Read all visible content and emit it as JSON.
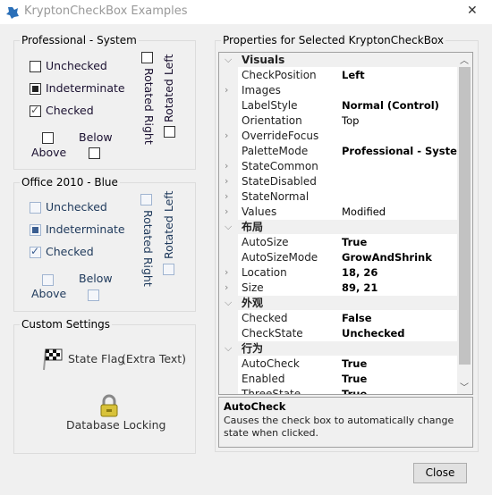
{
  "window": {
    "title": "KryptonCheckBox Examples"
  },
  "groups": {
    "professional": {
      "title": "Professional - System",
      "unchecked": "Unchecked",
      "indeterminate": "Indeterminate",
      "checked": "Checked",
      "above": "Above",
      "below": "Below",
      "rotated_right": "Rotated Right",
      "rotated_left": "Rotated Left"
    },
    "office": {
      "title": "Office 2010 - Blue",
      "unchecked": "Unchecked",
      "indeterminate": "Indeterminate",
      "checked": "Checked",
      "above": "Above",
      "below": "Below",
      "rotated_right": "Rotated Right",
      "rotated_left": "Rotated Left"
    },
    "custom": {
      "title": "Custom Settings",
      "state_flag": "State Flag",
      "extra_text": "(Extra Text)",
      "database_locking": "Database Locking"
    }
  },
  "properties": {
    "title": "Properties for Selected KryptonCheckBox",
    "rows": [
      {
        "label": "Visuals",
        "type": "category"
      },
      {
        "label": "CheckPosition",
        "value": "Left",
        "bold": true
      },
      {
        "label": "Images",
        "value": "",
        "expand": true
      },
      {
        "label": "LabelStyle",
        "value": "Normal (Control)",
        "bold": true
      },
      {
        "label": "Orientation",
        "value": "Top"
      },
      {
        "label": "OverrideFocus",
        "value": "",
        "expand": true
      },
      {
        "label": "PaletteMode",
        "value": "Professional - System",
        "bold": true
      },
      {
        "label": "StateCommon",
        "value": "",
        "expand": true
      },
      {
        "label": "StateDisabled",
        "value": "",
        "expand": true
      },
      {
        "label": "StateNormal",
        "value": "",
        "expand": true
      },
      {
        "label": "Values",
        "value": "Modified",
        "expand": true
      },
      {
        "label": "布局",
        "type": "category"
      },
      {
        "label": "AutoSize",
        "value": "True",
        "bold": true
      },
      {
        "label": "AutoSizeMode",
        "value": "GrowAndShrink",
        "bold": true
      },
      {
        "label": "Location",
        "value": "18, 26",
        "bold": true,
        "expand": true
      },
      {
        "label": "Size",
        "value": "89, 21",
        "bold": true,
        "expand": true
      },
      {
        "label": "外观",
        "type": "category"
      },
      {
        "label": "Checked",
        "value": "False",
        "bold": true
      },
      {
        "label": "CheckState",
        "value": "Unchecked",
        "bold": true
      },
      {
        "label": "行为",
        "type": "category"
      },
      {
        "label": "AutoCheck",
        "value": "True",
        "bold": true
      },
      {
        "label": "Enabled",
        "value": "True",
        "bold": true
      },
      {
        "label": "ThreeState",
        "value": "True",
        "bold": true
      }
    ],
    "description": {
      "title": "AutoCheck",
      "text": "Causes the check box to automatically change state when clicked."
    }
  },
  "buttons": {
    "close": "Close"
  }
}
